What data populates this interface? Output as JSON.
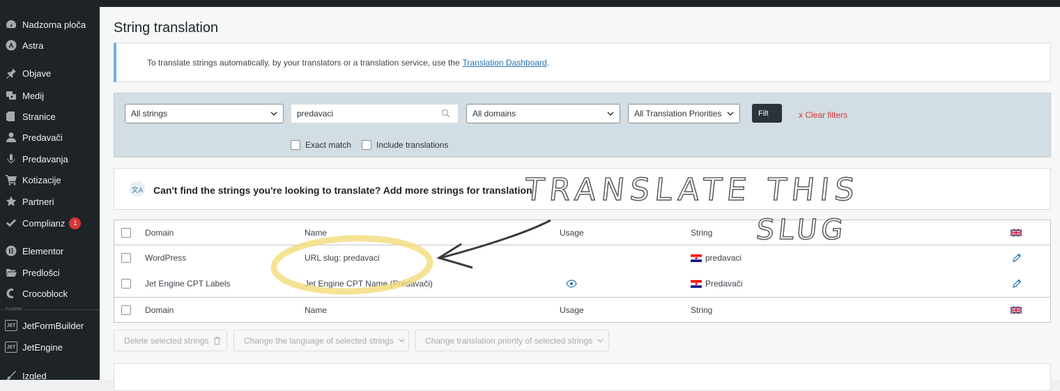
{
  "sidebar": {
    "items": [
      {
        "label": "Nadzorna ploča",
        "icon": "dashboard-icon"
      },
      {
        "label": "Astra",
        "icon": "astra-icon"
      },
      {
        "label": "Objave",
        "icon": "pin-icon"
      },
      {
        "label": "Medij",
        "icon": "media-icon"
      },
      {
        "label": "Stranice",
        "icon": "pages-icon"
      },
      {
        "label": "Predavači",
        "icon": "user-icon"
      },
      {
        "label": "Predavanja",
        "icon": "microphone-icon"
      },
      {
        "label": "Kotizacije",
        "icon": "cart-icon"
      },
      {
        "label": "Partneri",
        "icon": "star-icon"
      },
      {
        "label": "Complianz",
        "icon": "check-icon",
        "badge": "1"
      },
      {
        "label": "Elementor",
        "icon": "elementor-icon"
      },
      {
        "label": "Predlošci",
        "icon": "folder-icon"
      },
      {
        "label": "Crocoblock",
        "icon": "crocoblock-icon"
      },
      {
        "label": "JetFormBuilder",
        "icon": "jet-icon"
      },
      {
        "label": "JetEngine",
        "icon": "jet-icon"
      },
      {
        "label": "Izgled",
        "icon": "brush-icon"
      }
    ],
    "plugins_tag": "PLUGINS",
    "jet_abbr": "JET"
  },
  "page": {
    "title": "String translation",
    "notice_text": "To translate strings automatically, by your translators or a translation service, use the",
    "notice_link": "Translation Dashboard",
    "notice_end": "."
  },
  "filters": {
    "strings_select": "All strings",
    "search_value": "predavaci",
    "domains_select": "All domains",
    "priorities_select": "All Translation Priorities",
    "filter_button": "Filt",
    "clear_filters": "x  Clear filters",
    "exact_match": "Exact match",
    "include_translations": "Include translations"
  },
  "add_strings": {
    "icon_glyph": "文A",
    "text": "Can't find the strings you're looking to translate? Add more strings for translation."
  },
  "table": {
    "headers": {
      "domain": "Domain",
      "name": "Name",
      "usage": "Usage",
      "string": "String"
    },
    "rows": [
      {
        "domain": "WordPress",
        "name": "URL slug: predavaci",
        "string": "predavaci"
      },
      {
        "domain": "Jet Engine CPT Labels",
        "name": "Jet Engine CPT Name (Predavači)",
        "string": "Predavači"
      }
    ]
  },
  "bulk": {
    "delete": "Delete selected strings",
    "change_language": "Change the language of selected strings",
    "change_priority": "Change translation priority of selected strings"
  },
  "annotation": {
    "text_line1": "TRANSLATE THIS",
    "text_line2": "SLUG",
    "circle_color": "#f2dc7a"
  },
  "colors": {
    "sidebar_bg": "#1d2327",
    "link": "#2271b1",
    "danger": "#d63638",
    "filter_bg": "#d2dde4"
  }
}
